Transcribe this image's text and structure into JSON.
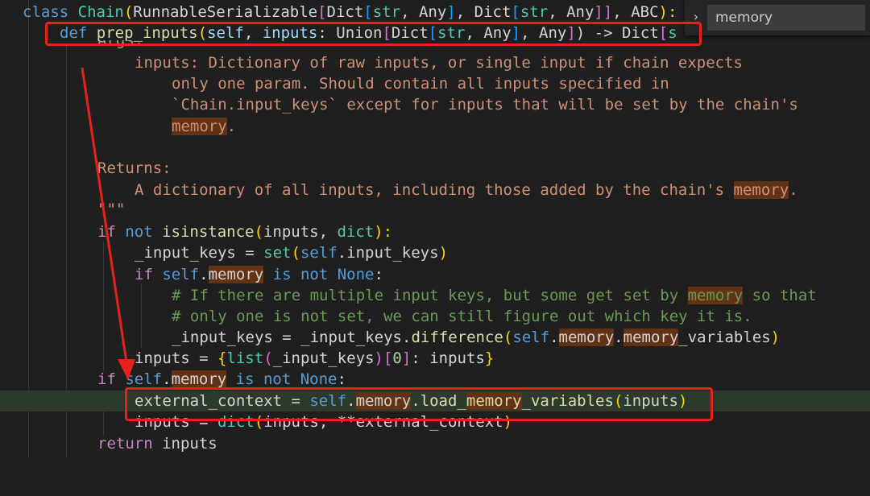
{
  "find": {
    "query": "memory",
    "toggle_glyph": "›"
  },
  "code": {
    "l1": {
      "a": "class ",
      "b": "Chain",
      "c": "(",
      "d": "RunnableSerializable",
      "e": "[",
      "f": "Dict",
      "g": "[",
      "h": "str",
      "i": ", ",
      "j": "Any",
      "k": "]",
      "l": ", ",
      "m": "Dict",
      "n": "[",
      "o": "str",
      "p": ", ",
      "q": "Any",
      "r": "]]",
      "s": ", ",
      "t": "ABC",
      "u": "):"
    },
    "l2": {
      "a": "def ",
      "b": "prep_inputs",
      "c": "(",
      "d": "self",
      "e": ", ",
      "f": "inputs",
      "g": ": ",
      "h": "Union",
      "i": "[",
      "j": "Dict",
      "k": "[",
      "l": "str",
      "m": ", ",
      "n": "Any",
      "o": "]",
      "p": ", ",
      "q": "Any",
      "r": "]",
      "s": ") -> ",
      "t": "Dict",
      "u": "[",
      "v": "s"
    },
    "l2b": {
      "a": "Args:"
    },
    "l3": {
      "a": "inputs: Dictionary of raw inputs, or single input if chain expects"
    },
    "l4": {
      "a": "only one param. Should contain all inputs specified in"
    },
    "l5": {
      "a": "`Chain.input_keys` except for inputs that will be set by the chain's"
    },
    "l6": {
      "a": "memory",
      "b": "."
    },
    "l8": {
      "a": "Returns:"
    },
    "l9": {
      "a": "A dictionary of all inputs, including those added by the chain's ",
      "b": "memory",
      "c": "."
    },
    "l10": {
      "a": "\"\"\""
    },
    "l11": {
      "a": "if",
      "b": " not ",
      "c": "isinstance",
      "d": "(",
      "e": "inputs",
      "f": ", ",
      "g": "dict",
      "h": "):"
    },
    "l12": {
      "a": "_input_keys",
      "b": " = ",
      "c": "set",
      "d": "(",
      "e": "self",
      "f": ".",
      "g": "input_keys",
      "h": ")"
    },
    "l13": {
      "a": "if",
      "b": " ",
      "c": "self",
      "d": ".",
      "e": "memory",
      "f": " is not ",
      "g": "None",
      "h": ":"
    },
    "l14": {
      "a": "# If there are multiple input keys, but some get set by ",
      "b": "memory",
      "c": " so that"
    },
    "l15": {
      "a": "# only one is not set, we can still figure out which key it is."
    },
    "l16": {
      "a": "_input_keys",
      "b": " = ",
      "c": "_input_keys",
      "d": ".",
      "e": "difference",
      "f": "(",
      "g": "self",
      "h": ".",
      "i": "memory",
      "j": ".",
      "k": "memory",
      "l": "_variables",
      "m": ")"
    },
    "l17": {
      "a": "inputs",
      "b": " = ",
      "c": "{",
      "d": "list",
      "e": "(",
      "f": "_input_keys",
      "g": ")",
      "h": "[",
      "i": "0",
      "j": "]",
      "k": ": ",
      "l": "inputs",
      "m": "}"
    },
    "l18": {
      "a": "if",
      "b": " ",
      "c": "self",
      "d": ".",
      "e": "memory",
      "f": " is not ",
      "g": "None",
      "h": ":"
    },
    "l19": {
      "a": "external_context",
      "b": " = ",
      "c": "self",
      "d": ".",
      "e": "memory",
      "f": ".",
      "g": "load_",
      "h": "memory",
      "i": "_variables",
      "j": "(",
      "k": "inputs",
      "l": ")"
    },
    "l20": {
      "a": "inputs",
      "b": " = ",
      "c": "dict",
      "d": "(",
      "e": "inputs",
      "f": ", **",
      "g": "external_context",
      "h": ")"
    },
    "l21": {
      "a": "return",
      "b": " ",
      "c": "inputs"
    }
  },
  "colors": {
    "annotation": "#e8201b",
    "current_line": "#2b3a2b",
    "match_highlight": "#613214"
  }
}
